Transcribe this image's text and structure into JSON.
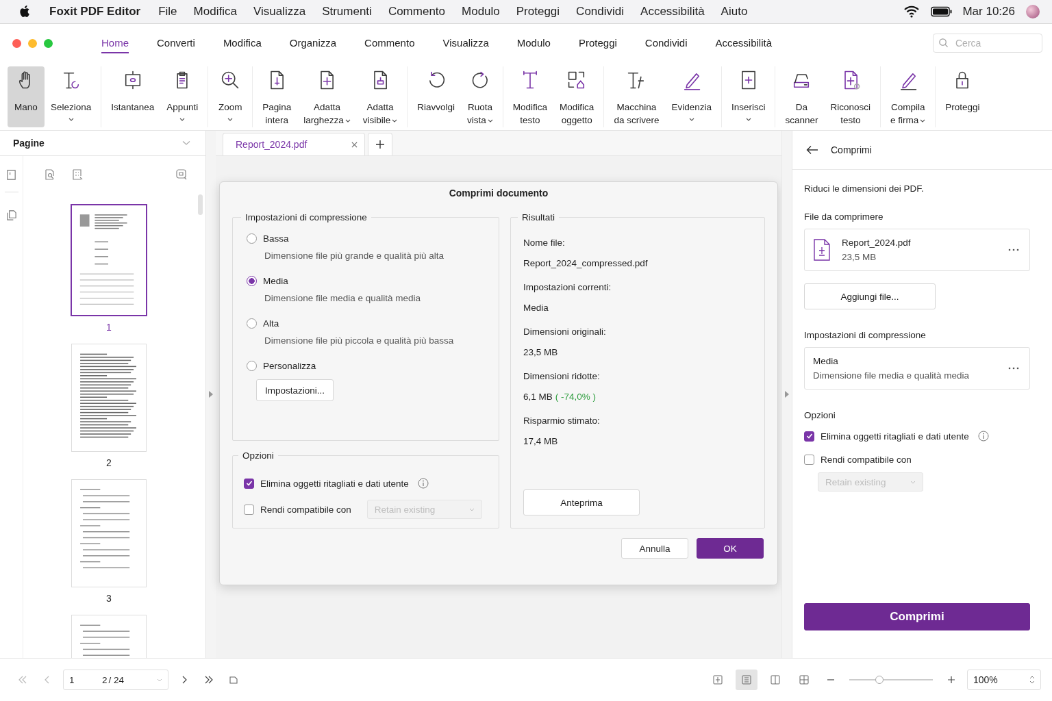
{
  "menubar": {
    "app": "Foxit PDF Editor",
    "items": [
      "File",
      "Modifica",
      "Visualizza",
      "Strumenti",
      "Commento",
      "Modulo",
      "Proteggi",
      "Condividi",
      "Accessibilità",
      "Aiuto"
    ],
    "clock": "Mar 10:26"
  },
  "tabs": [
    {
      "label": "Home",
      "selected": true
    },
    {
      "label": "Converti",
      "selected": false
    },
    {
      "label": "Modifica",
      "selected": false
    },
    {
      "label": "Organizza",
      "selected": false
    },
    {
      "label": "Commento",
      "selected": false
    },
    {
      "label": "Visualizza",
      "selected": false
    },
    {
      "label": "Modulo",
      "selected": false
    },
    {
      "label": "Proteggi",
      "selected": false
    },
    {
      "label": "Condividi",
      "selected": false
    },
    {
      "label": "Accessibilità",
      "selected": false
    }
  ],
  "search": {
    "placeholder": "Cerca"
  },
  "ribbon": [
    {
      "tools": [
        {
          "lines": [
            "Mano"
          ],
          "dropdown": false,
          "selected": true
        },
        {
          "lines": [
            "Seleziona"
          ],
          "dropdown": true,
          "selected": false
        }
      ]
    },
    {
      "tools": [
        {
          "lines": [
            "Istantanea"
          ],
          "dropdown": false,
          "selected": false
        },
        {
          "lines": [
            "Appunti"
          ],
          "dropdown": true,
          "selected": false
        }
      ]
    },
    {
      "tools": [
        {
          "lines": [
            "Zoom"
          ],
          "dropdown": true,
          "selected": false
        }
      ]
    },
    {
      "tools": [
        {
          "lines": [
            "Pagina",
            "intera"
          ],
          "dropdown": false,
          "selected": false
        },
        {
          "lines": [
            "Adatta",
            "larghezza"
          ],
          "dropdown": true,
          "selected": false
        },
        {
          "lines": [
            "Adatta",
            "visibile"
          ],
          "dropdown": true,
          "selected": false
        }
      ]
    },
    {
      "tools": [
        {
          "lines": [
            "Riavvolgi"
          ],
          "dropdown": false,
          "selected": false
        },
        {
          "lines": [
            "Ruota",
            "vista"
          ],
          "dropdown": true,
          "selected": false
        }
      ]
    },
    {
      "tools": [
        {
          "lines": [
            "Modifica",
            "testo"
          ],
          "dropdown": false,
          "selected": false
        },
        {
          "lines": [
            "Modifica",
            "oggetto"
          ],
          "dropdown": false,
          "selected": false
        }
      ]
    },
    {
      "tools": [
        {
          "lines": [
            "Macchina",
            "da scrivere"
          ],
          "dropdown": false,
          "selected": false
        },
        {
          "lines": [
            "Evidenzia"
          ],
          "dropdown": true,
          "selected": false
        }
      ]
    },
    {
      "tools": [
        {
          "lines": [
            "Inserisci"
          ],
          "dropdown": true,
          "selected": false
        }
      ]
    },
    {
      "tools": [
        {
          "lines": [
            "Da",
            "scanner"
          ],
          "dropdown": false,
          "selected": false
        },
        {
          "lines": [
            "Riconosci",
            "testo"
          ],
          "dropdown": false,
          "selected": false
        }
      ]
    },
    {
      "tools": [
        {
          "lines": [
            "Compila",
            "e firma"
          ],
          "dropdown": true,
          "selected": false
        }
      ]
    },
    {
      "tools": [
        {
          "lines": [
            "Proteggi"
          ],
          "dropdown": false,
          "selected": false
        }
      ]
    }
  ],
  "sidebar": {
    "title": "Pagine",
    "pages": [
      {
        "number": "1",
        "selected": true
      },
      {
        "number": "2",
        "selected": false
      },
      {
        "number": "3",
        "selected": false
      },
      {
        "selected": false
      }
    ]
  },
  "doc_tabs": [
    {
      "label": "Report_2024.pdf",
      "selected": true
    }
  ],
  "dialog": {
    "title": "Comprimi documento",
    "compression": {
      "legend": "Impostazioni di compressione",
      "options": [
        {
          "label": "Bassa",
          "description": "Dimensione file più grande e qualità più alta",
          "selected": false
        },
        {
          "label": "Media",
          "description": "Dimensione file media e qualità media",
          "selected": true
        },
        {
          "label": "Alta",
          "description": "Dimensione file più piccola e qualità più bassa",
          "selected": false
        },
        {
          "label": "Personalizza",
          "button": "Impostazioni...",
          "selected": false
        }
      ]
    },
    "options": {
      "legend": "Opzioni",
      "items": [
        {
          "label": "Elimina oggetti ritagliati e dati utente",
          "checked": true,
          "info": true
        },
        {
          "label": "Rendi compatibile con",
          "checked": false,
          "info": false,
          "select": {
            "value": "Retain existing",
            "disabled": true
          }
        }
      ]
    },
    "results": {
      "legend": "Risultati",
      "rows": [
        {
          "label": "Nome file:",
          "value": "Report_2024_compressed.pdf"
        },
        {
          "label": "Impostazioni correnti:",
          "value": "Media"
        },
        {
          "label": "Dimensioni originali:",
          "value": "23,5 MB"
        },
        {
          "label": "Dimensioni ridotte:",
          "value": "6,1 MB",
          "note": "( -74,0% )"
        },
        {
          "label": "Risparmio stimato:",
          "value": "17,4 MB"
        }
      ],
      "preview": "Anteprima"
    },
    "buttons": [
      {
        "label": "Annulla",
        "kind": "secondary"
      },
      {
        "label": "OK",
        "kind": "primary"
      }
    ]
  },
  "panel": {
    "title": "Comprimi",
    "description": "Riduci le dimensioni dei PDF.",
    "files_label": "File da comprimere",
    "file": {
      "name": "Report_2024.pdf",
      "size": "23,5 MB"
    },
    "add_button": "Aggiungi file...",
    "settings_label": "Impostazioni di compressione",
    "setting": {
      "title": "Media",
      "description": "Dimensione file media e qualità media"
    },
    "options_label": "Opzioni",
    "options": [
      {
        "label": "Elimina oggetti ritagliati e dati utente",
        "checked": true,
        "info": true
      },
      {
        "label": "Rendi compatibile con",
        "checked": false,
        "info": false
      }
    ],
    "select": {
      "value": "Retain existing",
      "disabled": true
    },
    "submit": "Comprimi"
  },
  "status_bar": {
    "page": "1",
    "current": "2",
    "total": "/ 24",
    "views": [
      {
        "selected": false
      },
      {
        "selected": true
      },
      {
        "selected": false
      },
      {
        "selected": false
      }
    ],
    "zoom_slider": {
      "level": 0.36
    },
    "zoom": "100%"
  }
}
